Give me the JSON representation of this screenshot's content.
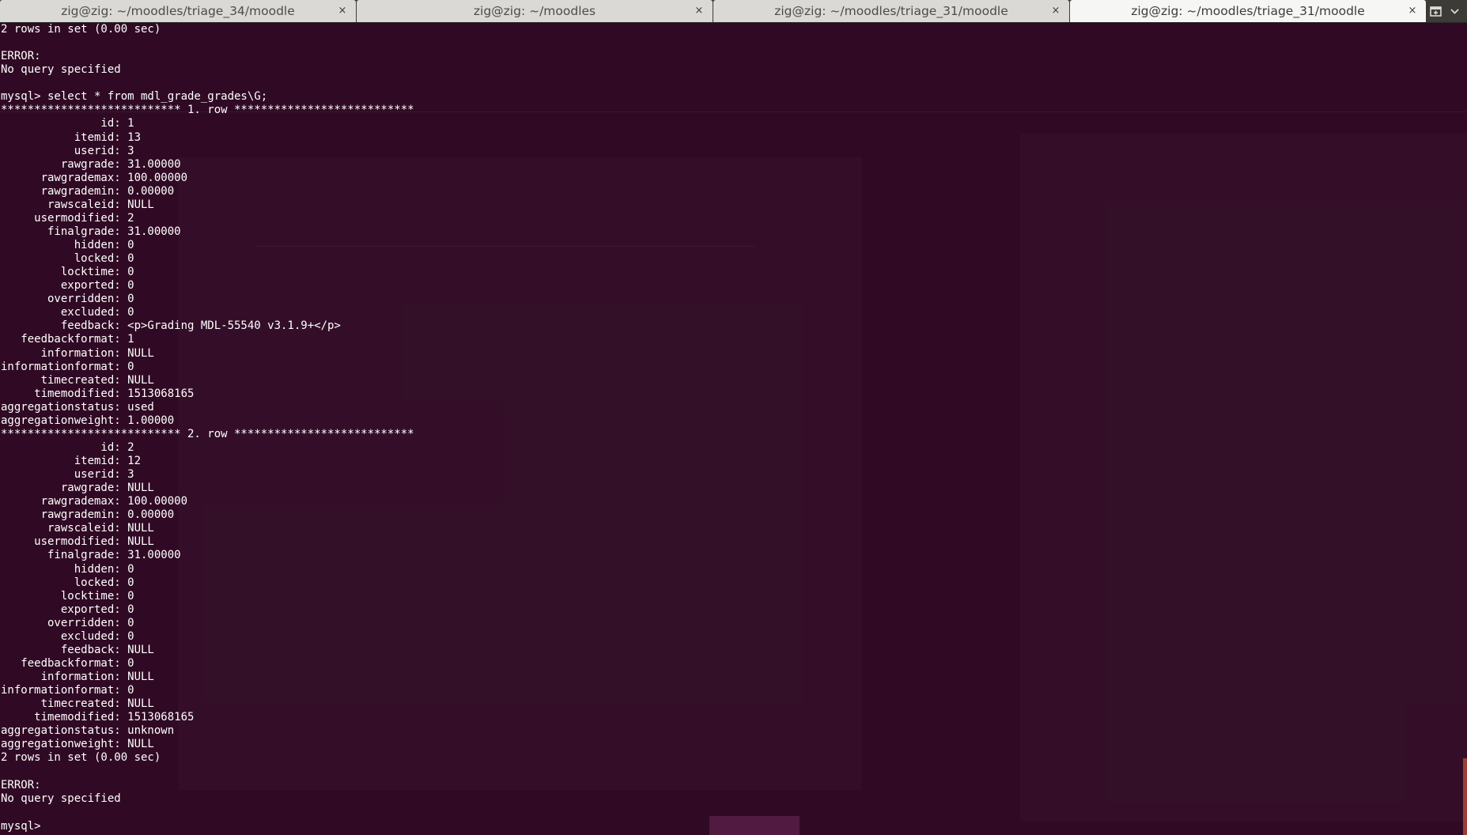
{
  "tabs": [
    {
      "title": "zig@zig: ~/moodles/triage_34/moodle",
      "active": false
    },
    {
      "title": "zig@zig: ~/moodles",
      "active": false
    },
    {
      "title": "zig@zig: ~/moodles/triage_31/moodle",
      "active": false
    },
    {
      "title": "zig@zig: ~/moodles/triage_31/moodle",
      "active": true
    }
  ],
  "tab_close_glyph": "×",
  "tab_actions": {
    "new_tab_icon": "new-tab-icon",
    "menu_icon": "chevron-down-icon"
  },
  "colors": {
    "terminal_bg": "#300a24",
    "terminal_fg": "#ffffff",
    "tabbar_bg": "#3c3b37",
    "active_tab_bg": "#f6f6f4",
    "inactive_tab_bg": "#dad9d5",
    "scrollbar": "#c0503a"
  },
  "terminal": {
    "lines": [
      "2 rows in set (0.00 sec)",
      "",
      "ERROR:",
      "No query specified",
      "",
      "mysql> select * from mdl_grade_grades\\G;",
      "*************************** 1. row ***************************",
      "               id: 1",
      "           itemid: 13",
      "           userid: 3",
      "         rawgrade: 31.00000",
      "      rawgrademax: 100.00000",
      "      rawgrademin: 0.00000",
      "       rawscaleid: NULL",
      "     usermodified: 2",
      "       finalgrade: 31.00000",
      "           hidden: 0",
      "           locked: 0",
      "         locktime: 0",
      "         exported: 0",
      "       overridden: 0",
      "         excluded: 0",
      "         feedback: <p>Grading MDL-55540 v3.1.9+</p>",
      "   feedbackformat: 1",
      "      information: NULL",
      "informationformat: 0",
      "      timecreated: NULL",
      "     timemodified: 1513068165",
      "aggregationstatus: used",
      "aggregationweight: 1.00000",
      "*************************** 2. row ***************************",
      "               id: 2",
      "           itemid: 12",
      "           userid: 3",
      "         rawgrade: NULL",
      "      rawgrademax: 100.00000",
      "      rawgrademin: 0.00000",
      "       rawscaleid: NULL",
      "     usermodified: NULL",
      "       finalgrade: 31.00000",
      "           hidden: 0",
      "           locked: 0",
      "         locktime: 0",
      "         exported: 0",
      "       overridden: 0",
      "         excluded: 0",
      "         feedback: NULL",
      "   feedbackformat: 0",
      "      information: NULL",
      "informationformat: 0",
      "      timecreated: NULL",
      "     timemodified: 1513068165",
      "aggregationstatus: unknown",
      "aggregationweight: NULL",
      "2 rows in set (0.00 sec)",
      "",
      "ERROR:",
      "No query specified",
      "",
      "mysql> "
    ]
  }
}
